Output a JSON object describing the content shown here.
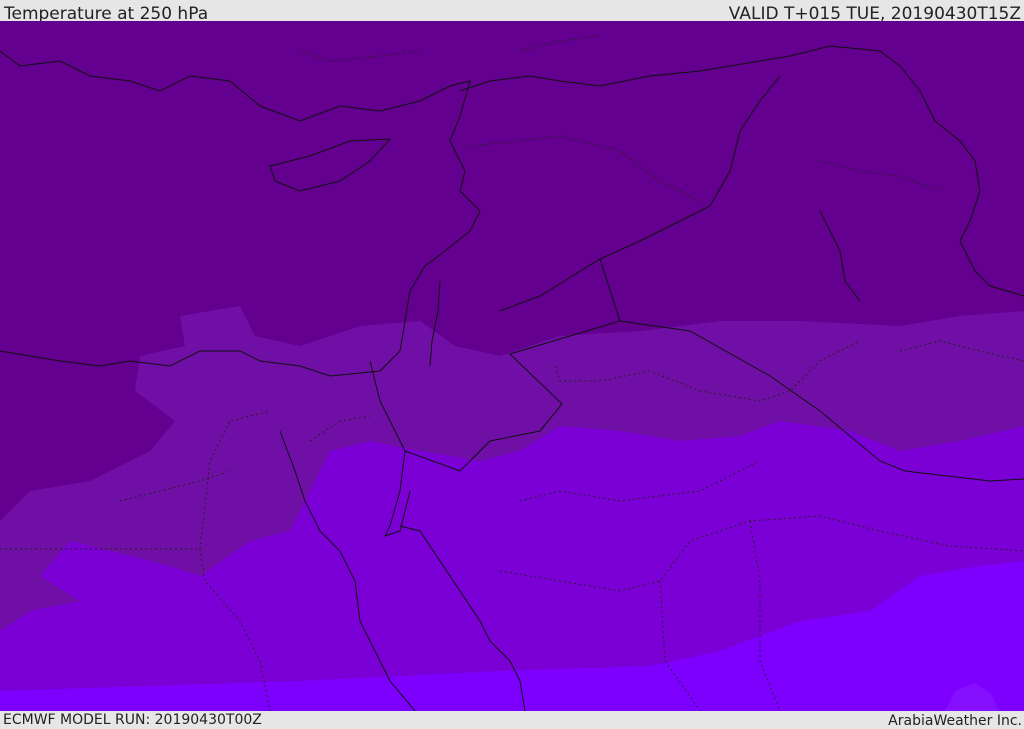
{
  "header": {
    "title": "Temperature at 250 hPa",
    "valid_time": "VALID T+015 TUE, 20190430T15Z"
  },
  "footer": {
    "model_run": "ECMWF MODEL RUN: 20190430T00Z",
    "credit": "ArabiaWeather Inc."
  },
  "map": {
    "field": "temperature",
    "level": "250 hPa",
    "colors": {
      "coldest": "#63008f",
      "cold": "#6f0fa6",
      "mid": "#7a00d6",
      "warm": "#7d00ff",
      "warmest": "#8410ff"
    }
  }
}
